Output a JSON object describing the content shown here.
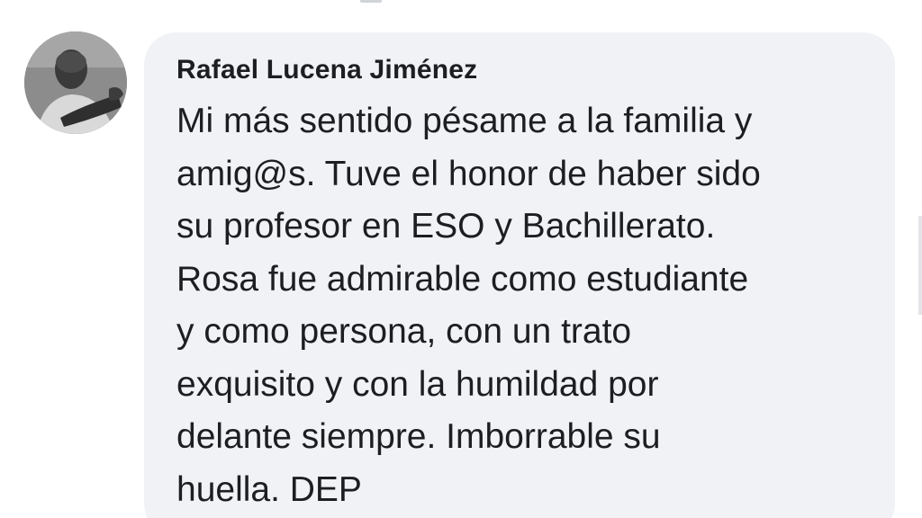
{
  "comment": {
    "author": "Rafael Lucena Jiménez",
    "lines": [
      "Mi más sentido pésame a la familia y",
      "amig@s. Tuve el honor de haber sido",
      "su profesor en ESO y Bachillerato.",
      "Rosa fue admirable como estudiante",
      "y como persona, con un trato",
      "exquisito y con la humildad por",
      "delante siempre. Imborrable su",
      "huella. DEP"
    ]
  },
  "colors": {
    "bubble_background": "#f0f2f5",
    "text": "#1c1e21",
    "page_background": "#ffffff"
  }
}
